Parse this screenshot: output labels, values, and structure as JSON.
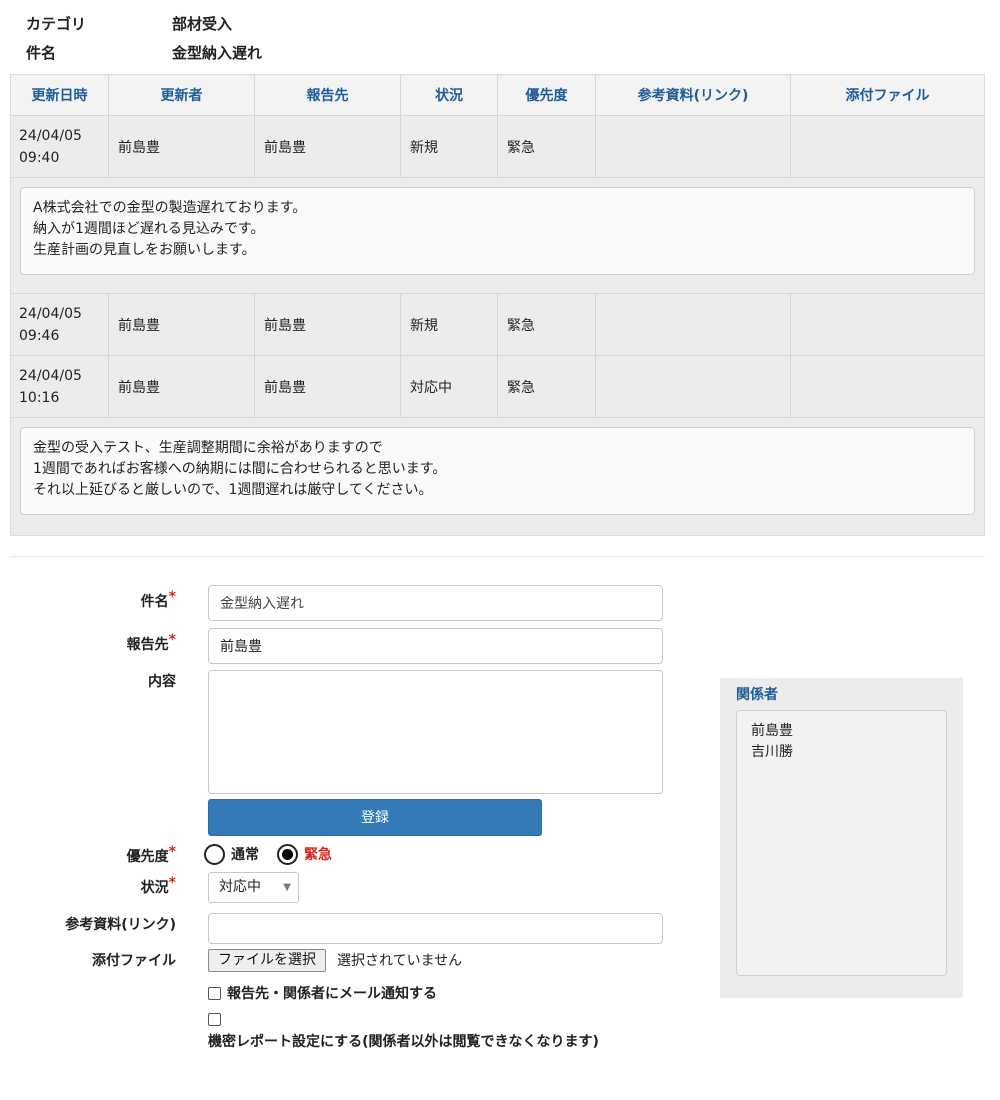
{
  "header": {
    "category_label": "カテゴリ",
    "category_value": "部材受入",
    "subject_label": "件名",
    "subject_value": "金型納入遅れ"
  },
  "history": {
    "columns": [
      "更新日時",
      "更新者",
      "報告先",
      "状況",
      "優先度",
      "参考資料(リンク)",
      "添付ファイル"
    ],
    "rows": [
      {
        "date": "24/04/05",
        "time": "09:40",
        "updater": "前島豊",
        "report_to": "前島豊",
        "status": "新規",
        "priority": "緊急",
        "link": "",
        "attachment": ""
      },
      {
        "date": "24/04/05",
        "time": "09:46",
        "updater": "前島豊",
        "report_to": "前島豊",
        "status": "新規",
        "priority": "緊急",
        "link": "",
        "attachment": ""
      },
      {
        "date": "24/04/05",
        "time": "10:16",
        "updater": "前島豊",
        "report_to": "前島豊",
        "status": "対応中",
        "priority": "緊急",
        "link": "",
        "attachment": ""
      }
    ],
    "messages": [
      [
        "A株式会社での金型の製造遅れております。",
        "納入が1週間ほど遅れる見込みです。",
        "生産計画の見直しをお願いします。"
      ],
      [
        "金型の受入テスト、生産調整期間に余裕がありますので",
        "1週間であればお客様への納期には間に合わせられると思います。",
        "それ以上延びると厳しいので、1週間遅れは厳守してください。"
      ]
    ]
  },
  "form": {
    "subject_label": "件名",
    "subject_value": "金型納入遅れ",
    "report_to_label": "報告先",
    "report_to_value": "前島豊",
    "content_label": "内容",
    "content_value": "",
    "submit_label": "登録",
    "priority_label": "優先度",
    "priority_options": [
      "通常",
      "緊急"
    ],
    "priority_selected": "緊急",
    "status_label": "状況",
    "status_value": "対応中",
    "link_label": "参考資料(リンク)",
    "link_value": "",
    "attachment_label": "添付ファイル",
    "file_button_label": "ファイルを選択",
    "file_status": "選択されていません",
    "notify_label": "報告先・関係者にメール通知する",
    "confidential_label": "機密レポート設定にする(関係者以外は閲覧できなくなります)",
    "required_mark": "*"
  },
  "related": {
    "title": "関係者",
    "members": [
      "前島豊",
      "吉川勝"
    ]
  },
  "colors": {
    "accent_blue": "#1f5c99",
    "button_blue": "#337ab7",
    "required_red": "#d9261c",
    "panel_gray": "#ececec"
  }
}
